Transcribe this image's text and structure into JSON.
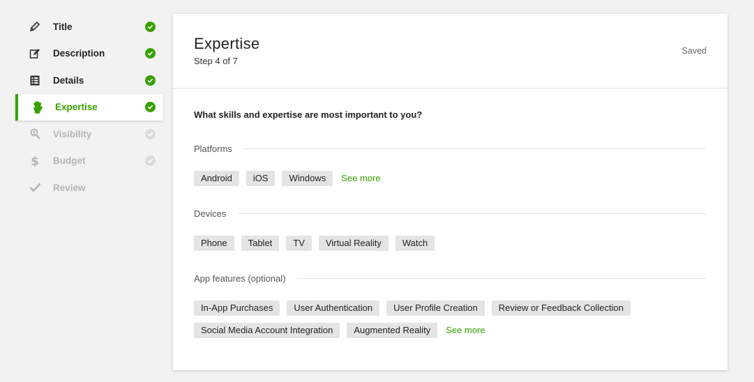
{
  "sidebar": {
    "steps": [
      {
        "label": "Title",
        "icon": "pencil-icon",
        "state": "done"
      },
      {
        "label": "Description",
        "icon": "edit-icon",
        "state": "done"
      },
      {
        "label": "Details",
        "icon": "list-icon",
        "state": "done"
      },
      {
        "label": "Expertise",
        "icon": "hand-icon",
        "state": "active"
      },
      {
        "label": "Visibility",
        "icon": "user-search-icon",
        "state": "disabled"
      },
      {
        "label": "Budget",
        "icon": "dollar-icon",
        "state": "disabled"
      },
      {
        "label": "Review",
        "icon": "checkmark-icon",
        "state": "disabled"
      }
    ],
    "accent": "#37a000"
  },
  "header": {
    "title": "Expertise",
    "step": "Step 4 of 7",
    "status": "Saved"
  },
  "main": {
    "question": "What skills and expertise are most important to you?",
    "sections": [
      {
        "label": "Platforms",
        "chips": [
          "Android",
          "iOS",
          "Windows"
        ],
        "see_more": "See more"
      },
      {
        "label": "Devices",
        "chips": [
          "Phone",
          "Tablet",
          "TV",
          "Virtual Reality",
          "Watch"
        ]
      },
      {
        "label": "App features (optional)",
        "chips": [
          "In-App Purchases",
          "User Authentication",
          "User Profile Creation",
          "Review or Feedback Collection",
          "Social Media Account Integration",
          "Augmented Reality"
        ],
        "see_more": "See more"
      }
    ]
  }
}
